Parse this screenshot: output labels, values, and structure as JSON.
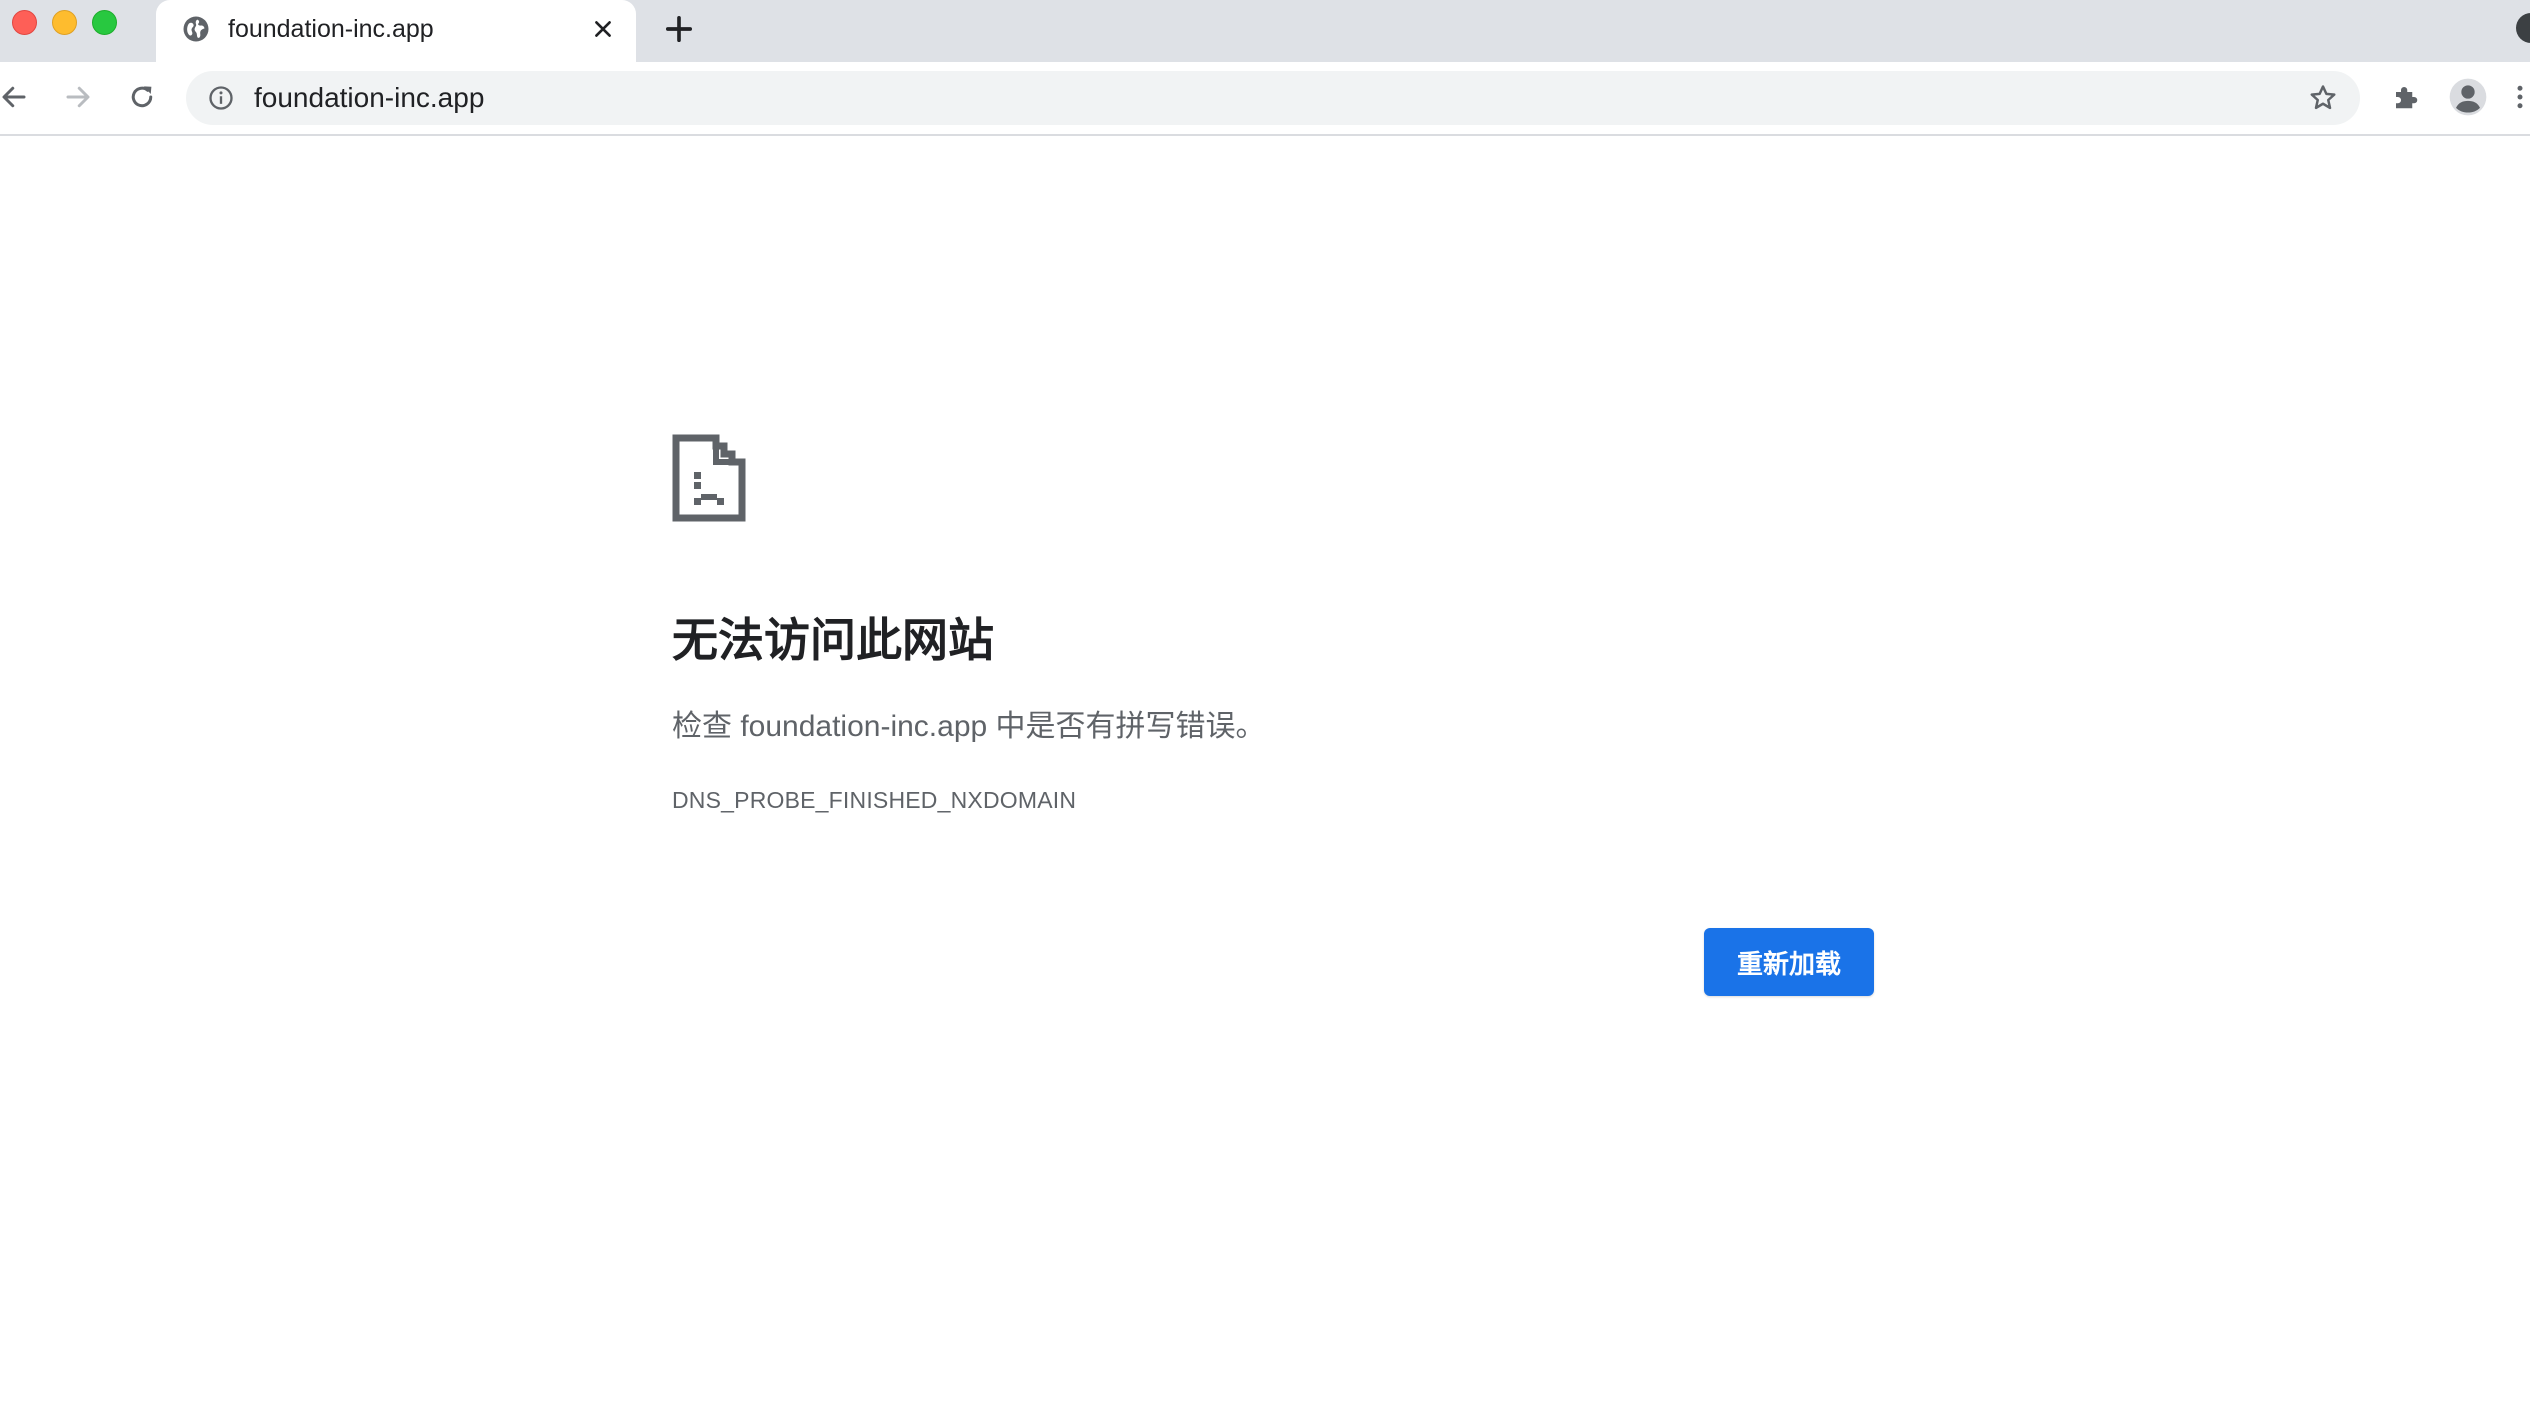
{
  "browser": {
    "tab": {
      "title": "foundation-inc.app",
      "favicon": "globe-icon"
    },
    "omnibox": {
      "url": "foundation-inc.app",
      "info_icon": "info-icon",
      "bookmark_icon": "star-icon"
    },
    "toolbar_icons": {
      "back": "arrow-left-icon",
      "forward": "arrow-right-icon",
      "reload": "reload-icon",
      "extensions": "puzzle-icon",
      "profile": "person-icon"
    }
  },
  "error_page": {
    "icon": "sad-document-icon",
    "title": "无法访问此网站",
    "description": "检查 foundation-inc.app 中是否有拼写错误。",
    "error_code": "DNS_PROBE_FINISHED_NXDOMAIN",
    "reload_label": "重新加载"
  },
  "colors": {
    "tabstrip_bg": "#dee1e6",
    "omnibox_bg": "#f1f3f4",
    "accent": "#1a73e8",
    "text_primary": "#202124",
    "text_secondary": "#5f6368"
  }
}
